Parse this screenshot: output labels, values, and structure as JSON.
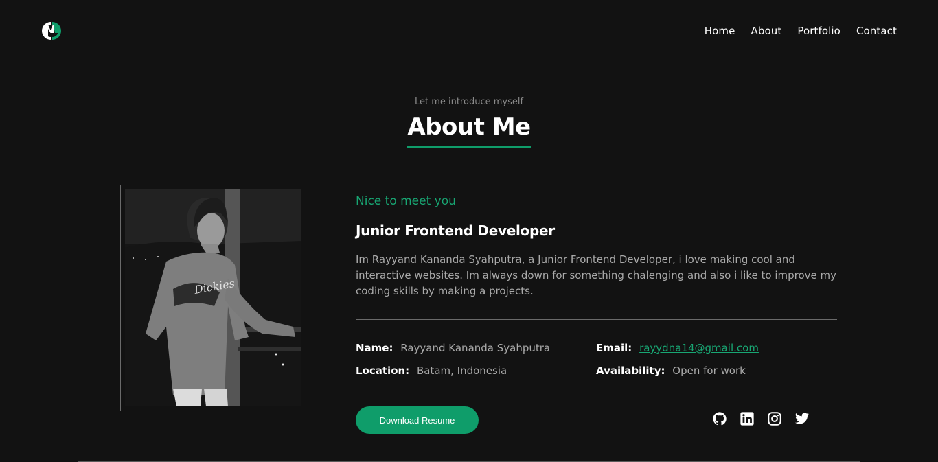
{
  "nav": {
    "links": [
      {
        "label": "Home"
      },
      {
        "label": "About"
      },
      {
        "label": "Portfolio"
      },
      {
        "label": "Contact"
      }
    ],
    "active": "About"
  },
  "hero": {
    "intro": "Let me introduce myself",
    "title": "About Me"
  },
  "about": {
    "greeting": "Nice to meet you",
    "role": "Junior Frontend Developer",
    "bio": "Im Rayyand Kananda Syahputra, a Junior Frontend Developer, i love making cool and interactive websites. Im always down for something chalenging and also i like to improve my coding skills by making a projects.",
    "info": {
      "name_label": "Name:",
      "name_value": "Rayyand Kananda Syahputra",
      "email_label": "Email:",
      "email_value": "rayydna14@gmail.com",
      "location_label": "Location:",
      "location_value": "Batam, Indonesia",
      "availability_label": "Availability:",
      "availability_value": "Open for work"
    },
    "download_label": "Download Resume"
  },
  "social": {
    "icons": [
      "github-icon",
      "linkedin-icon",
      "instagram-icon",
      "twitter-icon"
    ]
  },
  "colors": {
    "accent": "#0f9d6a",
    "background": "#121212"
  }
}
